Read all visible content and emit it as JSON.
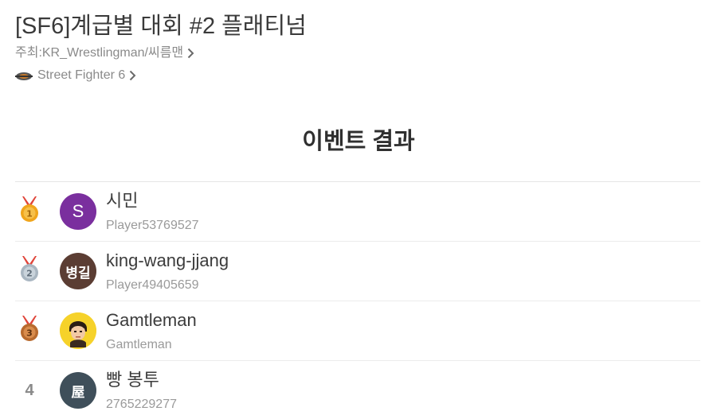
{
  "header": {
    "title": "[SF6]계급별 대회 #2 플래티넘",
    "organizer": "주최:KR_Wrestlingman/씨름맨",
    "game": "Street Fighter 6"
  },
  "section_title": "이벤트 결과",
  "results": [
    {
      "rank": "1",
      "medal": "gold",
      "avatar_text": "S",
      "avatar_color": "#7a2f9e",
      "name": "시민",
      "sub": "Player53769527"
    },
    {
      "rank": "2",
      "medal": "silver",
      "avatar_text": "병길",
      "avatar_color": "#5b3d33",
      "name": "king-wang-jjang",
      "sub": "Player49405659"
    },
    {
      "rank": "3",
      "medal": "bronze",
      "avatar_text": "",
      "avatar_color": "#f6d22a",
      "name": "Gamtleman",
      "sub": "Gamtleman"
    },
    {
      "rank": "4",
      "medal": "",
      "avatar_text": "屋",
      "avatar_color": "#3f4f5a",
      "name": "빵 봉투",
      "sub": "2765229277"
    }
  ],
  "colors": {
    "gold": "#f0a51c",
    "silver": "#a9b6c1",
    "bronze": "#b86a2e",
    "ribbon": "#e0453a"
  }
}
